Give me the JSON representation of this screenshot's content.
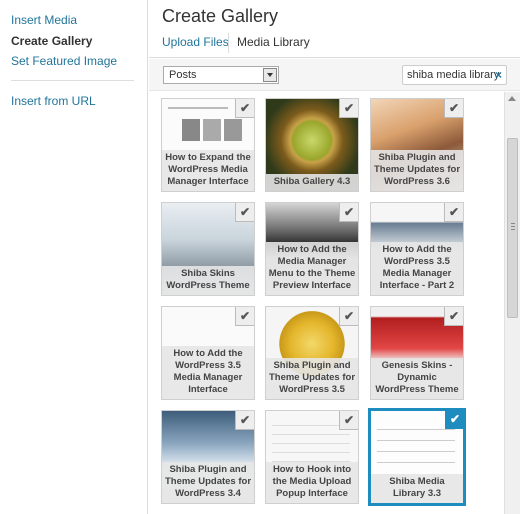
{
  "sidebar": {
    "items": [
      {
        "label": "Insert Media",
        "active": false
      },
      {
        "label": "Create Gallery",
        "active": true
      },
      {
        "label": "Set Featured Image",
        "active": false
      },
      {
        "label": "Insert from URL",
        "active": false
      }
    ]
  },
  "main": {
    "title": "Create Gallery",
    "tabs": [
      {
        "label": "Upload Files",
        "active": false
      },
      {
        "label": "Media Library",
        "active": true
      }
    ]
  },
  "toolbar": {
    "filter_value": "Posts",
    "search_value": "shiba media library",
    "clear_symbol": "×"
  },
  "tiles": [
    {
      "caption": "How to Expand the WordPress Media Manager Interface",
      "style": "doc",
      "selected": false
    },
    {
      "caption": "Shiba Gallery 4.3",
      "style": "gold",
      "selected": false
    },
    {
      "caption": "Shiba Plugin and Theme Updates for WordPress 3.6",
      "style": "fantasy",
      "selected": false
    },
    {
      "caption": "Shiba Skins WordPress Theme",
      "style": "snow",
      "selected": false
    },
    {
      "caption": "How to Add the Media Manager Menu to the Theme Preview Interface",
      "style": "dark",
      "selected": false
    },
    {
      "caption": "How to Add the WordPress 3.5 Media Manager Interface - Part 2",
      "style": "web",
      "selected": false
    },
    {
      "caption": "How to Add the WordPress 3.5 Media Manager Interface",
      "style": "white",
      "selected": false
    },
    {
      "caption": "Shiba Plugin and Theme Updates for WordPress 3.5",
      "style": "skull",
      "selected": false
    },
    {
      "caption": "Genesis Skins - Dynamic WordPress Theme",
      "style": "red",
      "selected": false
    },
    {
      "caption": "Shiba Plugin and Theme Updates for WordPress 3.4",
      "style": "blue",
      "selected": false
    },
    {
      "caption": "How to Hook into the Media Upload Popup Interface",
      "style": "form",
      "selected": false
    },
    {
      "caption": "Shiba Media Library 3.3",
      "style": "list",
      "selected": true
    }
  ],
  "check_symbol": "✔",
  "accent_color": "#1e8cbe",
  "link_color": "#21759b"
}
